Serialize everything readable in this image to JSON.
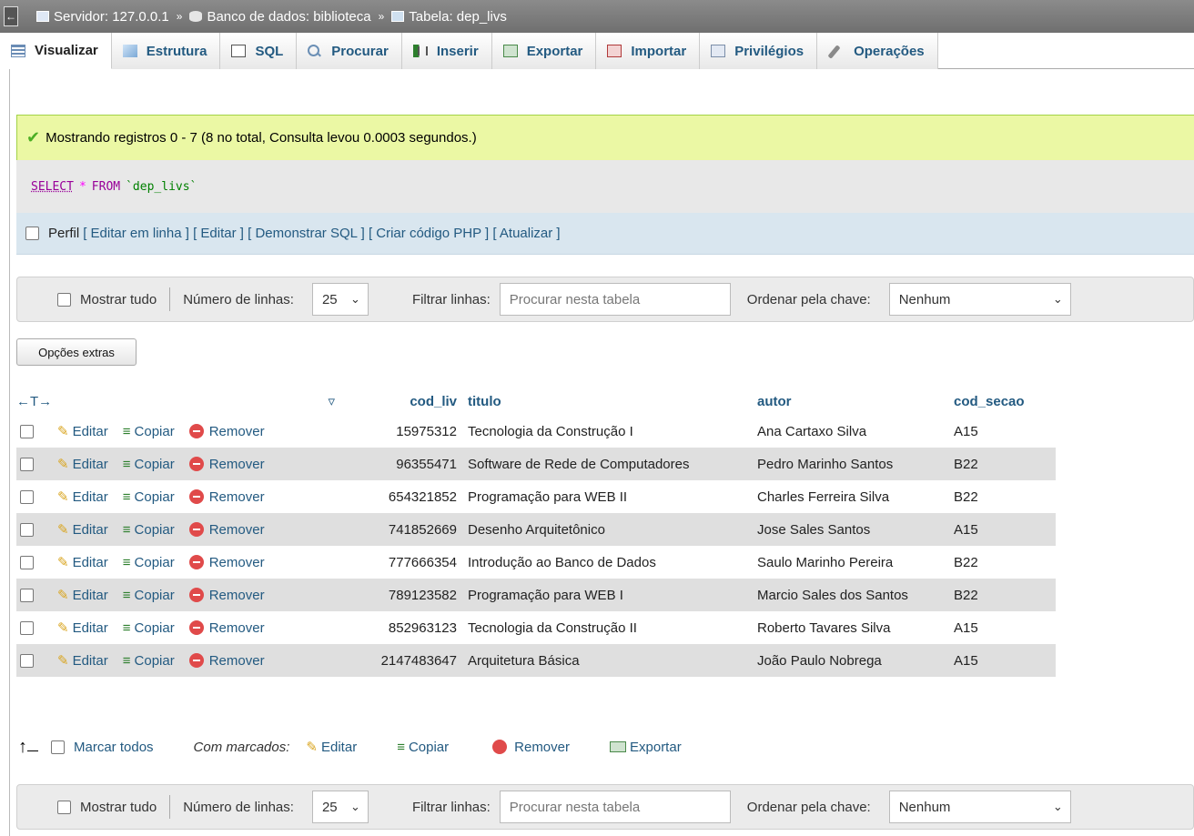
{
  "topbar": {
    "server": "Servidor: 127.0.0.1",
    "database": "Banco de dados: biblioteca",
    "table": "Tabela: dep_livs",
    "sep": "»",
    "back_icon": "arrow-left"
  },
  "tabs": [
    {
      "label": "Visualizar",
      "icon": "browse-icon"
    },
    {
      "label": "Estrutura",
      "icon": "structure-icon"
    },
    {
      "label": "SQL",
      "icon": "sql-icon"
    },
    {
      "label": "Procurar",
      "icon": "search-icon"
    },
    {
      "label": "Inserir",
      "icon": "insert-icon"
    },
    {
      "label": "Exportar",
      "icon": "export-icon"
    },
    {
      "label": "Importar",
      "icon": "import-icon"
    },
    {
      "label": "Privilégios",
      "icon": "privileges-icon"
    },
    {
      "label": "Operações",
      "icon": "operations-icon"
    }
  ],
  "message": "Mostrando registros 0 - 7 (8 no total, Consulta levou 0.0003 segundos.)",
  "sql": {
    "select": "SELECT",
    "star": "*",
    "from": "FROM",
    "table": "`dep_livs`"
  },
  "perfil": {
    "label": "Perfil",
    "links": [
      "[ Editar em linha ]",
      "[ Editar ]",
      "[ Demonstrar SQL ]",
      "[ Criar código PHP ]",
      "[ Atualizar ]"
    ]
  },
  "nav": {
    "show_all": "Mostrar tudo",
    "rows_label": "Número de linhas:",
    "rows_value": "25",
    "filter_label": "Filtrar linhas:",
    "filter_placeholder": "Procurar nesta tabela",
    "sort_label": "Ordenar pela chave:",
    "sort_value": "Nenhum"
  },
  "extras_button": "Opções extras",
  "table": {
    "arrows": "←T→",
    "columns": [
      "cod_liv",
      "titulo",
      "autor",
      "cod_secao"
    ],
    "actions": {
      "edit": "Editar",
      "copy": "Copiar",
      "remove": "Remover"
    },
    "rows": [
      {
        "cod_liv": "15975312",
        "titulo": "Tecnologia da Construção I",
        "autor": "Ana Cartaxo Silva",
        "cod_secao": "A15"
      },
      {
        "cod_liv": "96355471",
        "titulo": "Software de Rede de Computadores",
        "autor": "Pedro Marinho Santos",
        "cod_secao": "B22"
      },
      {
        "cod_liv": "654321852",
        "titulo": "Programação para WEB II",
        "autor": "Charles Ferreira Silva",
        "cod_secao": "B22"
      },
      {
        "cod_liv": "741852669",
        "titulo": "Desenho Arquitetônico",
        "autor": "Jose Sales Santos",
        "cod_secao": "A15"
      },
      {
        "cod_liv": "777666354",
        "titulo": "Introdução ao Banco de Dados",
        "autor": "Saulo Marinho Pereira",
        "cod_secao": "B22"
      },
      {
        "cod_liv": "789123582",
        "titulo": "Programação para WEB I",
        "autor": "Marcio Sales dos Santos",
        "cod_secao": "B22"
      },
      {
        "cod_liv": "852963123",
        "titulo": "Tecnologia da Construção II",
        "autor": "Roberto Tavares Silva",
        "cod_secao": "A15"
      },
      {
        "cod_liv": "2147483647",
        "titulo": "Arquitetura Básica",
        "autor": "João Paulo Nobrega",
        "cod_secao": "A15"
      }
    ]
  },
  "bulk": {
    "check_all": "Marcar todos",
    "with_selected": "Com marcados:",
    "edit": "Editar",
    "copy": "Copiar",
    "remove": "Remover",
    "export": "Exportar"
  }
}
